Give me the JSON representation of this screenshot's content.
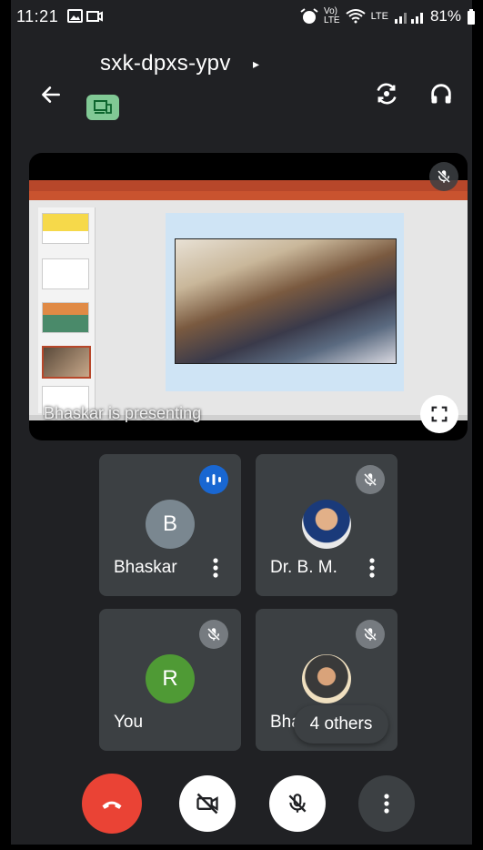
{
  "status_bar": {
    "time": "11:21",
    "network": "LTE",
    "battery": "81%"
  },
  "header": {
    "meeting_code": "sxk-dpxs-ypv",
    "caret": "▸"
  },
  "presentation": {
    "label": "Bhaskar is presenting"
  },
  "participants": [
    {
      "name": "Bhaskar",
      "initial": "B",
      "state": "speaking"
    },
    {
      "name": "Dr. B. M.",
      "initial": "",
      "state": "muted"
    },
    {
      "name": "You",
      "initial": "R",
      "state": "muted"
    },
    {
      "name": "Bhavik",
      "initial": "",
      "state": "muted"
    }
  ],
  "others_chip": "4 others",
  "colors": {
    "background": "#202124",
    "tile": "#3c4043",
    "end_call": "#ea4335",
    "speaking": "#1967d2",
    "device_badge": "#81c995"
  },
  "icons": {
    "back": "arrow-left-icon",
    "switch_camera": "switch-camera-icon",
    "audio": "headphones-icon",
    "mic_off": "mic-off-icon",
    "cam_off": "camera-off-icon",
    "end_call": "phone-end-icon",
    "more": "more-vert-icon",
    "fullscreen": "fullscreen-icon"
  }
}
